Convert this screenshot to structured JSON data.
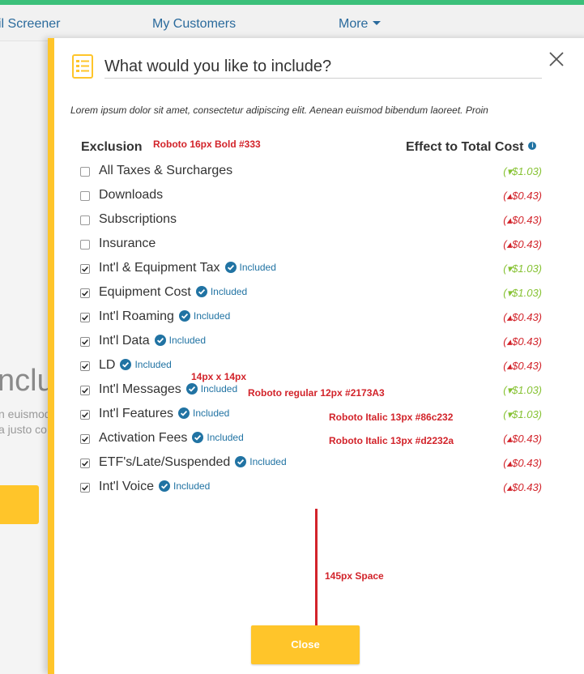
{
  "nav": {
    "items": [
      {
        "label": "il Screener"
      },
      {
        "label": "My Customers"
      },
      {
        "label": "More"
      }
    ]
  },
  "background": {
    "heading": "nclu",
    "text_line_1": "n euismod",
    "text_line_2": "a justo co"
  },
  "panel": {
    "title": "What would you like to include?",
    "intro": "Lorem ipsum dolor sit amet, consectetur adipiscing elit. Aenean euismod bibendum laoreet. Proin",
    "col_exclusion": "Exclusion",
    "col_effect": "Effect to Total Cost",
    "included_label": "Included",
    "close_label": "Close",
    "rows": [
      {
        "label": "All Taxes & Surcharges",
        "checked": false,
        "included": false,
        "cost": "(▾$1.03)",
        "direction": "down"
      },
      {
        "label": "Downloads",
        "checked": false,
        "included": false,
        "cost": "(▴$0.43)",
        "direction": "up"
      },
      {
        "label": "Subscriptions",
        "checked": false,
        "included": false,
        "cost": "(▴$0.43)",
        "direction": "up"
      },
      {
        "label": "Insurance",
        "checked": false,
        "included": false,
        "cost": "(▴$0.43)",
        "direction": "up"
      },
      {
        "label": "Int'l & Equipment Tax",
        "checked": true,
        "included": true,
        "cost": "(▾$1.03)",
        "direction": "down"
      },
      {
        "label": "Equipment Cost",
        "checked": true,
        "included": true,
        "cost": "(▾$1.03)",
        "direction": "down"
      },
      {
        "label": "Int'l Roaming",
        "checked": true,
        "included": true,
        "cost": "(▴$0.43)",
        "direction": "up"
      },
      {
        "label": "Int'l Data",
        "checked": true,
        "included": true,
        "cost": "(▴$0.43)",
        "direction": "up"
      },
      {
        "label": "LD",
        "checked": true,
        "included": true,
        "cost": "(▴$0.43)",
        "direction": "up"
      },
      {
        "label": "Int'l Messages",
        "checked": true,
        "included": true,
        "cost": "(▾$1.03)",
        "direction": "down"
      },
      {
        "label": "Int'l Features",
        "checked": true,
        "included": true,
        "cost": "(▾$1.03)",
        "direction": "down"
      },
      {
        "label": "Activation Fees",
        "checked": true,
        "included": true,
        "cost": "(▴$0.43)",
        "direction": "up"
      },
      {
        "label": "ETF's/Late/Suspended",
        "checked": true,
        "included": true,
        "cost": "(▴$0.43)",
        "direction": "up"
      },
      {
        "label": "Int'l Voice",
        "checked": true,
        "included": true,
        "cost": "(▴$0.43)",
        "direction": "up"
      }
    ]
  },
  "annotations": {
    "heading_spec": "Roboto 16px Bold #333",
    "icon_size": "14px x 14px",
    "included_spec": "Roboto regular 12px #2173A3",
    "green_spec": "Roboto Italic 13px #86c232",
    "red_spec": "Roboto Italic 13px #d2232a",
    "space_spec": "145px Space"
  },
  "colors": {
    "accent": "#ffc52a",
    "link": "#2173A3",
    "cost_up": "#d2232a",
    "cost_down": "#86c232",
    "nav_green": "#3cc07a"
  }
}
